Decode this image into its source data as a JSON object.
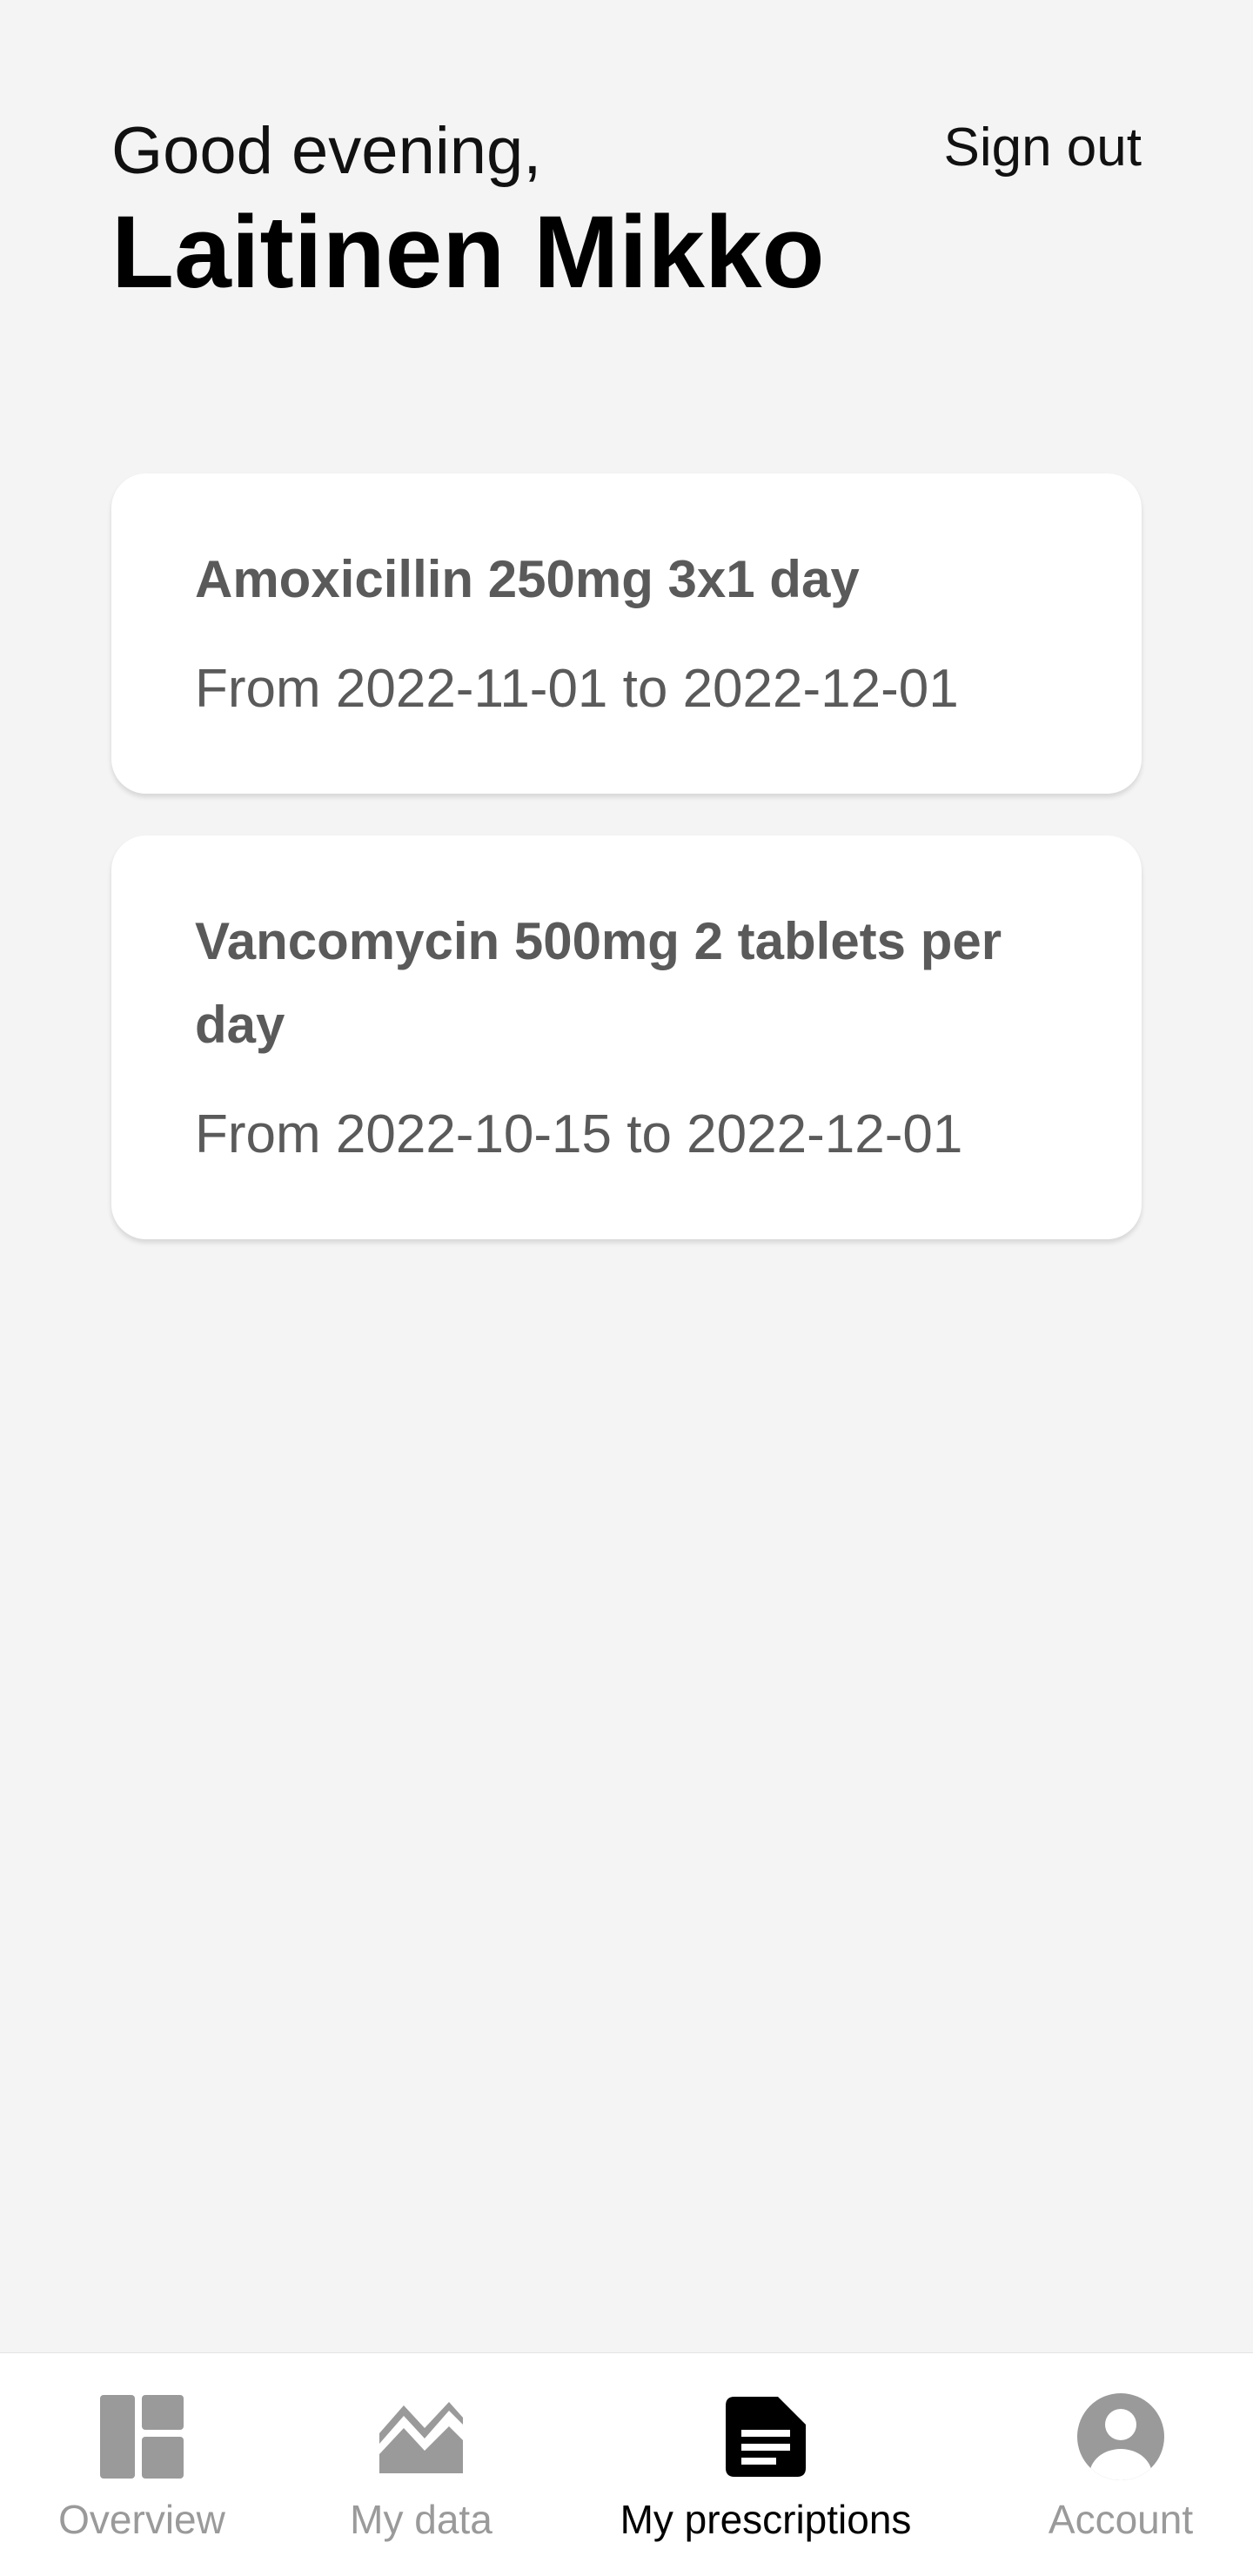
{
  "header": {
    "greeting": "Good evening,",
    "user_name": "Laitinen Mikko",
    "sign_out_label": "Sign out"
  },
  "prescriptions": [
    {
      "title": "Amoxicillin 250mg 3x1 day",
      "dates": "From 2022-11-01 to 2022-12-01"
    },
    {
      "title": "Vancomycin 500mg 2 tablets per day",
      "dates": "From 2022-10-15 to 2022-12-01"
    }
  ],
  "bottom_nav": {
    "items": [
      {
        "label": "Overview",
        "icon": "dashboard-icon",
        "active": false
      },
      {
        "label": "My data",
        "icon": "chart-icon",
        "active": false
      },
      {
        "label": "My prescriptions",
        "icon": "document-icon",
        "active": true
      },
      {
        "label": "Account",
        "icon": "account-circle-icon",
        "active": false
      }
    ]
  },
  "colors": {
    "background": "#f4f4f4",
    "card": "#ffffff",
    "card_text": "#5a5a5a",
    "nav_inactive": "#9a9a9a",
    "nav_active": "#000000"
  }
}
